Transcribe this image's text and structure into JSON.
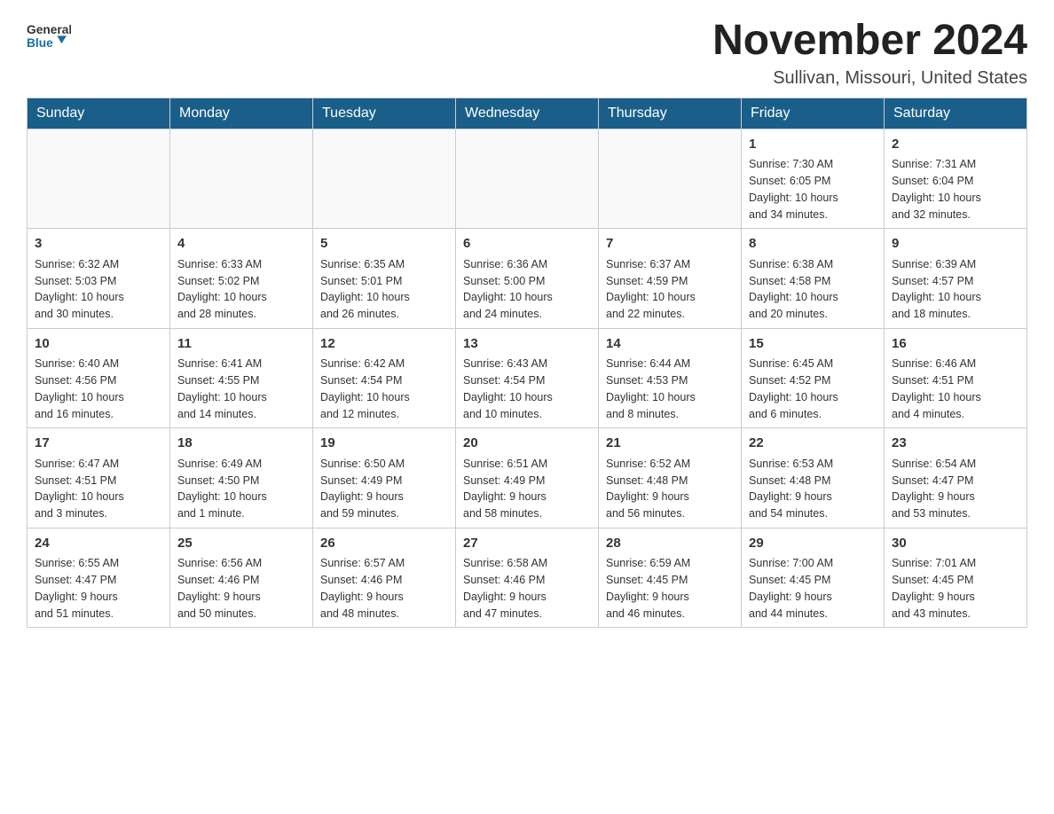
{
  "header": {
    "logo_general": "General",
    "logo_blue": "Blue",
    "month_title": "November 2024",
    "location": "Sullivan, Missouri, United States"
  },
  "days_of_week": [
    "Sunday",
    "Monday",
    "Tuesday",
    "Wednesday",
    "Thursday",
    "Friday",
    "Saturday"
  ],
  "weeks": [
    [
      {
        "day": "",
        "info": ""
      },
      {
        "day": "",
        "info": ""
      },
      {
        "day": "",
        "info": ""
      },
      {
        "day": "",
        "info": ""
      },
      {
        "day": "",
        "info": ""
      },
      {
        "day": "1",
        "info": "Sunrise: 7:30 AM\nSunset: 6:05 PM\nDaylight: 10 hours\nand 34 minutes."
      },
      {
        "day": "2",
        "info": "Sunrise: 7:31 AM\nSunset: 6:04 PM\nDaylight: 10 hours\nand 32 minutes."
      }
    ],
    [
      {
        "day": "3",
        "info": "Sunrise: 6:32 AM\nSunset: 5:03 PM\nDaylight: 10 hours\nand 30 minutes."
      },
      {
        "day": "4",
        "info": "Sunrise: 6:33 AM\nSunset: 5:02 PM\nDaylight: 10 hours\nand 28 minutes."
      },
      {
        "day": "5",
        "info": "Sunrise: 6:35 AM\nSunset: 5:01 PM\nDaylight: 10 hours\nand 26 minutes."
      },
      {
        "day": "6",
        "info": "Sunrise: 6:36 AM\nSunset: 5:00 PM\nDaylight: 10 hours\nand 24 minutes."
      },
      {
        "day": "7",
        "info": "Sunrise: 6:37 AM\nSunset: 4:59 PM\nDaylight: 10 hours\nand 22 minutes."
      },
      {
        "day": "8",
        "info": "Sunrise: 6:38 AM\nSunset: 4:58 PM\nDaylight: 10 hours\nand 20 minutes."
      },
      {
        "day": "9",
        "info": "Sunrise: 6:39 AM\nSunset: 4:57 PM\nDaylight: 10 hours\nand 18 minutes."
      }
    ],
    [
      {
        "day": "10",
        "info": "Sunrise: 6:40 AM\nSunset: 4:56 PM\nDaylight: 10 hours\nand 16 minutes."
      },
      {
        "day": "11",
        "info": "Sunrise: 6:41 AM\nSunset: 4:55 PM\nDaylight: 10 hours\nand 14 minutes."
      },
      {
        "day": "12",
        "info": "Sunrise: 6:42 AM\nSunset: 4:54 PM\nDaylight: 10 hours\nand 12 minutes."
      },
      {
        "day": "13",
        "info": "Sunrise: 6:43 AM\nSunset: 4:54 PM\nDaylight: 10 hours\nand 10 minutes."
      },
      {
        "day": "14",
        "info": "Sunrise: 6:44 AM\nSunset: 4:53 PM\nDaylight: 10 hours\nand 8 minutes."
      },
      {
        "day": "15",
        "info": "Sunrise: 6:45 AM\nSunset: 4:52 PM\nDaylight: 10 hours\nand 6 minutes."
      },
      {
        "day": "16",
        "info": "Sunrise: 6:46 AM\nSunset: 4:51 PM\nDaylight: 10 hours\nand 4 minutes."
      }
    ],
    [
      {
        "day": "17",
        "info": "Sunrise: 6:47 AM\nSunset: 4:51 PM\nDaylight: 10 hours\nand 3 minutes."
      },
      {
        "day": "18",
        "info": "Sunrise: 6:49 AM\nSunset: 4:50 PM\nDaylight: 10 hours\nand 1 minute."
      },
      {
        "day": "19",
        "info": "Sunrise: 6:50 AM\nSunset: 4:49 PM\nDaylight: 9 hours\nand 59 minutes."
      },
      {
        "day": "20",
        "info": "Sunrise: 6:51 AM\nSunset: 4:49 PM\nDaylight: 9 hours\nand 58 minutes."
      },
      {
        "day": "21",
        "info": "Sunrise: 6:52 AM\nSunset: 4:48 PM\nDaylight: 9 hours\nand 56 minutes."
      },
      {
        "day": "22",
        "info": "Sunrise: 6:53 AM\nSunset: 4:48 PM\nDaylight: 9 hours\nand 54 minutes."
      },
      {
        "day": "23",
        "info": "Sunrise: 6:54 AM\nSunset: 4:47 PM\nDaylight: 9 hours\nand 53 minutes."
      }
    ],
    [
      {
        "day": "24",
        "info": "Sunrise: 6:55 AM\nSunset: 4:47 PM\nDaylight: 9 hours\nand 51 minutes."
      },
      {
        "day": "25",
        "info": "Sunrise: 6:56 AM\nSunset: 4:46 PM\nDaylight: 9 hours\nand 50 minutes."
      },
      {
        "day": "26",
        "info": "Sunrise: 6:57 AM\nSunset: 4:46 PM\nDaylight: 9 hours\nand 48 minutes."
      },
      {
        "day": "27",
        "info": "Sunrise: 6:58 AM\nSunset: 4:46 PM\nDaylight: 9 hours\nand 47 minutes."
      },
      {
        "day": "28",
        "info": "Sunrise: 6:59 AM\nSunset: 4:45 PM\nDaylight: 9 hours\nand 46 minutes."
      },
      {
        "day": "29",
        "info": "Sunrise: 7:00 AM\nSunset: 4:45 PM\nDaylight: 9 hours\nand 44 minutes."
      },
      {
        "day": "30",
        "info": "Sunrise: 7:01 AM\nSunset: 4:45 PM\nDaylight: 9 hours\nand 43 minutes."
      }
    ]
  ]
}
